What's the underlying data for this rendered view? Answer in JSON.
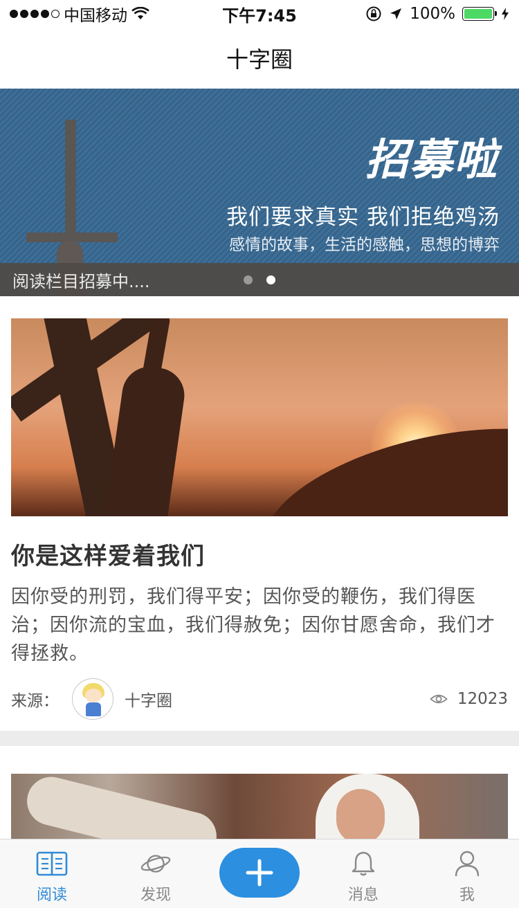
{
  "status_bar": {
    "carrier": "中国移动",
    "time": "下午7:45",
    "battery_percent": "100%",
    "battery_level": 1.0,
    "signal_bars": 4,
    "signal_total": 5
  },
  "nav": {
    "title": "十字圈"
  },
  "banner": {
    "headline": "招募啦",
    "line1": "我们要求真实 我们拒绝鸡汤",
    "line2": "感情的故事，生活的感触，思想的博弈",
    "caption": "阅读栏目招募中....",
    "slide_count": 2,
    "active_slide": 2
  },
  "articles": [
    {
      "title": "你是这样爱着我们",
      "summary": "因你受的刑罚，我们得平安；因你受的鞭伤，我们得医治；因你流的宝血，我们得赦免；因你甘愿舍命，我们才得拯救。",
      "source_label": "来源：",
      "source_name": "十字圈",
      "views": "12023"
    }
  ],
  "tab_bar": {
    "tabs": [
      {
        "label": "阅读",
        "icon": "book-icon",
        "active": true
      },
      {
        "label": "发现",
        "icon": "planet-icon",
        "active": false
      },
      {
        "label": "",
        "icon": "plus-icon",
        "active": false
      },
      {
        "label": "消息",
        "icon": "bell-icon",
        "active": false
      },
      {
        "label": "我",
        "icon": "person-icon",
        "active": false
      }
    ]
  },
  "colors": {
    "accent": "#2c8fe0",
    "tab_active": "#2e8bd8",
    "tab_inactive": "#888888",
    "banner_blue": "#3f6f98",
    "battery_green": "#4cd964"
  }
}
